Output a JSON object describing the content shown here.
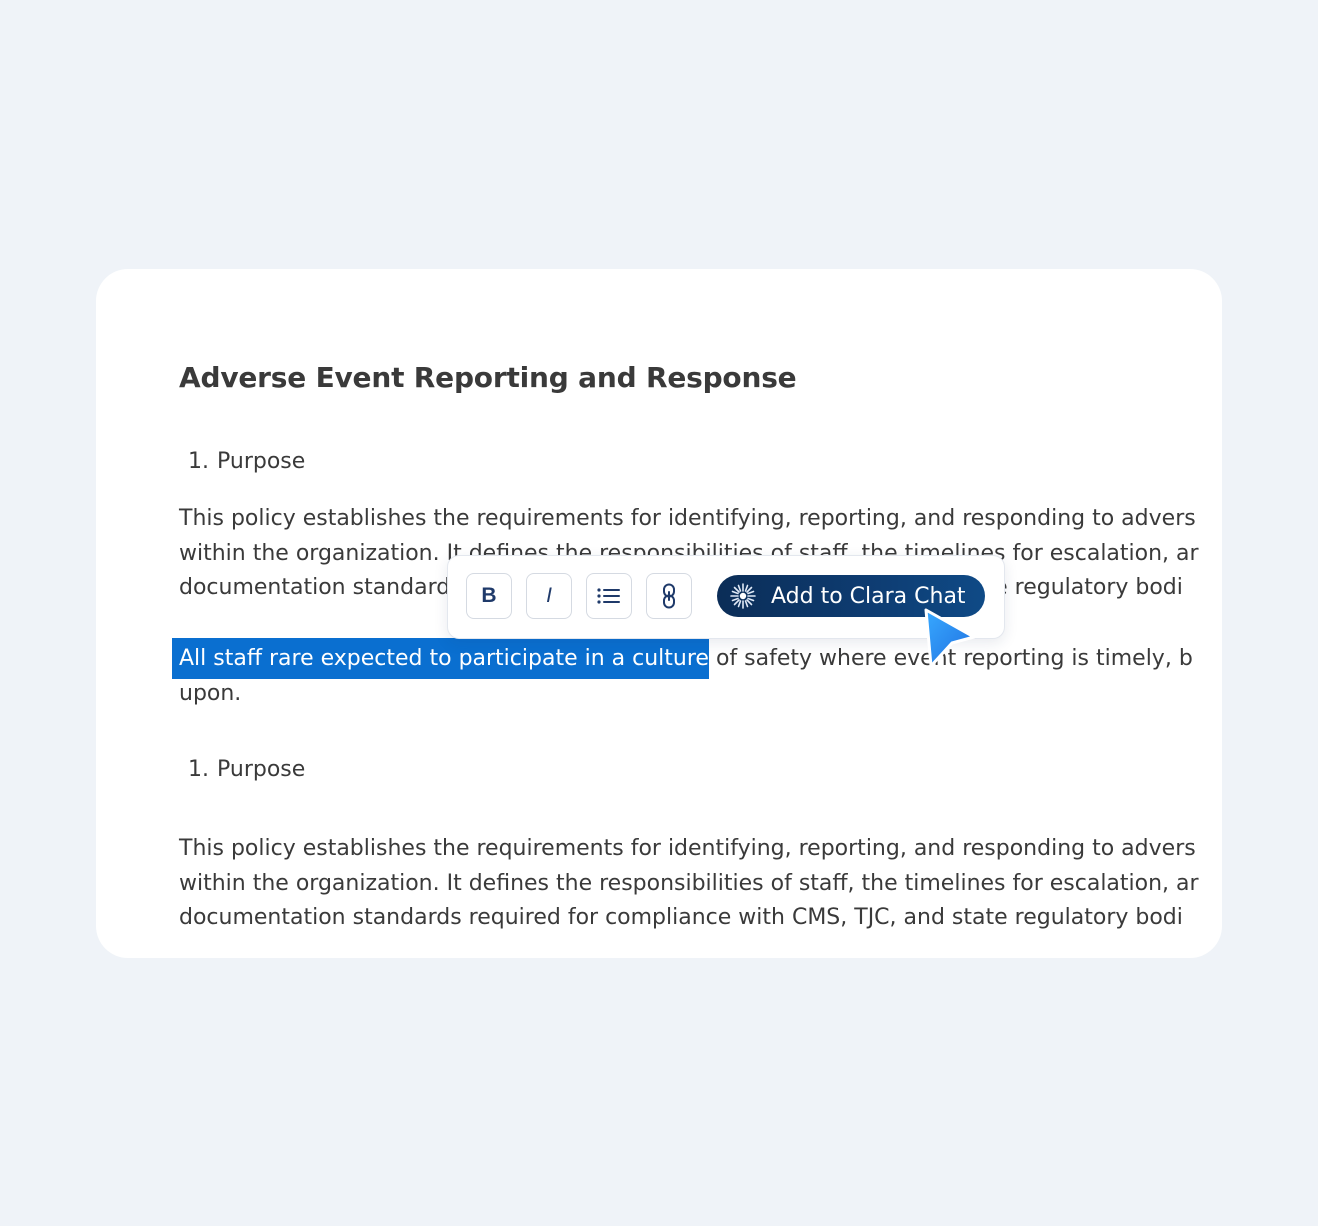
{
  "document": {
    "title": "Adverse Event Reporting and Response",
    "sections": [
      {
        "number": "1.",
        "heading": "Purpose",
        "paragraphs": [
          {
            "lines": [
              "This policy establishes the requirements for identifying, reporting, and responding to advers",
              "within the organization. It defines the responsibilities of staff, the timelines for escalation, ar",
              "documentation standards required for compliance with CMS, TJC, and state regulatory bodi"
            ]
          },
          {
            "highlighted": "All staff rare expected to participate in a culture",
            "rest": " of safety where event reporting is timely, b",
            "line2": "upon."
          }
        ]
      },
      {
        "number": "1.",
        "heading": "Purpose",
        "paragraphs": [
          {
            "lines": [
              "This policy establishes the requirements for identifying, reporting, and responding to advers",
              "within the organization. It defines the responsibilities of staff, the timelines for escalation, ar",
              "documentation standards required for compliance with CMS, TJC, and state regulatory bodi"
            ]
          }
        ]
      }
    ]
  },
  "toolbar": {
    "bold_label": "B",
    "italic_label": "I",
    "list_icon": "bullet-list-icon",
    "link_icon": "link-icon",
    "clara_label": "Add to Clara Chat",
    "clara_icon": "sparkle-icon"
  },
  "colors": {
    "background": "#eff3f8",
    "selection": "#0a6fd0",
    "clara_button": "#0e3d73",
    "cursor": "#2a8cf0",
    "text": "#3a3a3a"
  }
}
